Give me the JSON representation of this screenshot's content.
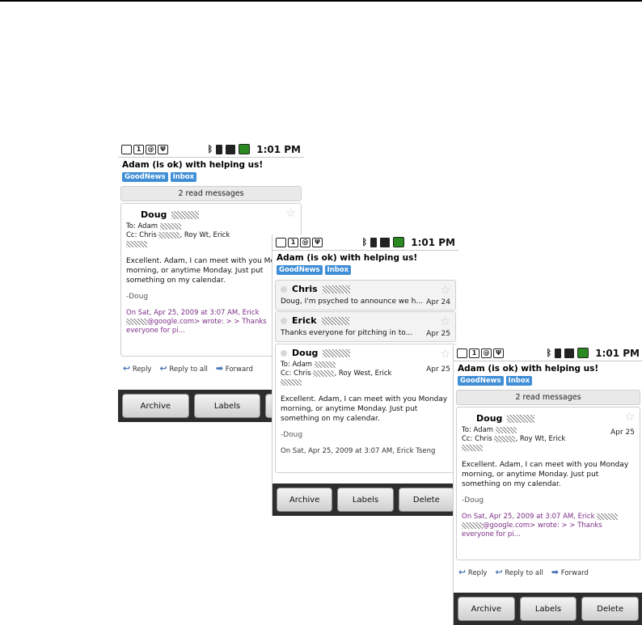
{
  "status": {
    "time": "1:01 PM",
    "icons": [
      "sim-icon",
      "one-icon",
      "voicemail-icon",
      "usb-icon",
      "bluetooth-icon",
      "vibrate-icon",
      "signal-icon",
      "battery-icon"
    ]
  },
  "thread": {
    "subject": "Adam (is ok) with helping us!",
    "labels": [
      "GoodNews",
      "Inbox"
    ]
  },
  "read_messages": "2 read messages",
  "message": {
    "sender": "Doug",
    "to": "To: Adam",
    "cc_prefix": "Cc: Chris",
    "cc_suffix": ", Roy West, Erick",
    "cc_suffix_alt": ", Roy W",
    "cc_suffix_alt2": "t, Erick",
    "date": "Apr 25",
    "body": "Excellent.  Adam, I can meet with you Monday morning, or anytime Monday.  Just put something on my calendar.",
    "sig": "-Doug",
    "quote1": "On Sat, Apr 25, 2009 at 3:07 AM, Erick",
    "quote2": "@google.com> wrote: > > Thanks",
    "quote3": "everyone for pi..."
  },
  "collapsed": [
    {
      "sender": "Chris",
      "snippet": "Doug, I'm psyched to announce we h...",
      "date": "Apr 24"
    },
    {
      "sender": "Erick",
      "snippet": "Thanks everyone for pitching in to...",
      "date": "Apr 25"
    }
  ],
  "partial_quote": "On Sat, Apr 25, 2009 at 3:07 AM, Erick Tseng",
  "actions": {
    "reply": "Reply",
    "reply_all": "Reply to all",
    "forward": "Forward"
  },
  "buttons": {
    "archive": "Archive",
    "labels": "Labels",
    "delete": "Delete"
  },
  "colors": {
    "label_bg": "#3f8ed6",
    "quote": "#7b2d86",
    "button_bar": "#2d2d2d"
  }
}
